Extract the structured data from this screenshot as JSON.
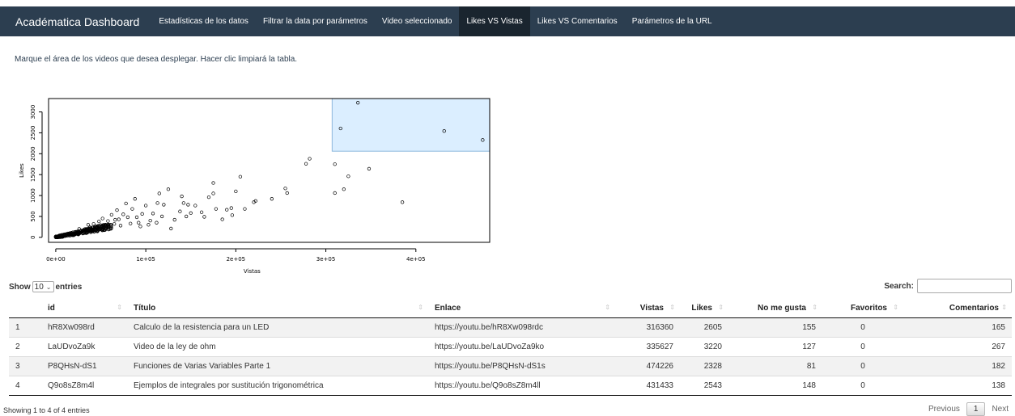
{
  "navbar": {
    "brand": "Académatica Dashboard",
    "tabs": [
      {
        "label": "Estadísticas de los datos",
        "active": false
      },
      {
        "label": "Filtrar la data por parámetros",
        "active": false
      },
      {
        "label": "Video seleccionado",
        "active": false
      },
      {
        "label": "Likes VS Vistas",
        "active": true
      },
      {
        "label": "Likes VS Comentarios",
        "active": false
      },
      {
        "label": "Parámetros de la URL",
        "active": false
      }
    ]
  },
  "instruction": "Marque el área de los videos que desea desplegar. Hacer clic limpiará la tabla.",
  "chart_data": {
    "type": "scatter",
    "xlabel": "Vistas",
    "ylabel": "Likes",
    "x_ticks": [
      0,
      100000,
      200000,
      300000,
      400000
    ],
    "x_tick_labels": [
      "0e+00",
      "1e+05",
      "2e+05",
      "3e+05",
      "4e+05"
    ],
    "y_ticks": [
      0,
      500,
      1000,
      1500,
      2000,
      2500,
      3000
    ],
    "y_tick_labels": [
      "0",
      "500",
      "1000",
      "1500",
      "2000",
      "2500",
      "3000"
    ],
    "xlim": [
      -8000,
      482000
    ],
    "ylim": [
      -120,
      3320
    ],
    "brush": {
      "x_min": 307000,
      "x_max": 482000,
      "y_min": 2060,
      "y_max": 3320,
      "color": "#dbeeff"
    },
    "points": [
      [
        316360,
        2605
      ],
      [
        335627,
        3220
      ],
      [
        474226,
        2328
      ],
      [
        431433,
        2543
      ],
      [
        282000,
        1880
      ],
      [
        278000,
        1760
      ],
      [
        310000,
        1750
      ],
      [
        348000,
        1640
      ],
      [
        325000,
        1460
      ],
      [
        320000,
        1150
      ],
      [
        310000,
        1060
      ],
      [
        385000,
        840
      ],
      [
        255000,
        1170
      ],
      [
        257000,
        1060
      ],
      [
        240000,
        920
      ],
      [
        222000,
        870
      ],
      [
        220000,
        840
      ],
      [
        205000,
        1450
      ],
      [
        200000,
        1100
      ],
      [
        195000,
        700
      ],
      [
        190000,
        660
      ],
      [
        196000,
        530
      ],
      [
        175000,
        1300
      ],
      [
        175000,
        1050
      ],
      [
        170000,
        960
      ],
      [
        178000,
        680
      ],
      [
        165000,
        490
      ],
      [
        150000,
        580
      ],
      [
        147000,
        780
      ],
      [
        145000,
        500
      ],
      [
        140000,
        980
      ],
      [
        138000,
        620
      ],
      [
        132000,
        420
      ],
      [
        128000,
        210
      ],
      [
        125000,
        1150
      ],
      [
        120000,
        780
      ],
      [
        118000,
        500
      ],
      [
        115000,
        1050
      ],
      [
        113000,
        820
      ],
      [
        108000,
        570
      ],
      [
        105000,
        400
      ],
      [
        100000,
        760
      ],
      [
        96000,
        560
      ],
      [
        92000,
        350
      ],
      [
        88000,
        920
      ],
      [
        85000,
        680
      ],
      [
        80000,
        480
      ],
      [
        78000,
        810
      ],
      [
        75000,
        550
      ],
      [
        70000,
        430
      ],
      [
        68000,
        650
      ],
      [
        65000,
        320
      ],
      [
        62000,
        540
      ],
      [
        58000,
        390
      ],
      [
        55000,
        300
      ],
      [
        52000,
        450
      ],
      [
        50000,
        250
      ],
      [
        48000,
        380
      ],
      [
        45000,
        180
      ],
      [
        42000,
        320
      ],
      [
        40000,
        140
      ],
      [
        38000,
        240
      ],
      [
        35000,
        110
      ],
      [
        32000,
        190
      ],
      [
        30000,
        90
      ],
      [
        28000,
        160
      ],
      [
        25000,
        70
      ],
      [
        22000,
        130
      ],
      [
        20000,
        50
      ],
      [
        18000,
        100
      ],
      [
        15000,
        40
      ],
      [
        12000,
        80
      ],
      [
        10000,
        30
      ],
      [
        8000,
        50
      ],
      [
        5000,
        20
      ],
      [
        3000,
        10
      ],
      [
        1000,
        5
      ],
      [
        60000,
        200
      ],
      [
        72000,
        280
      ],
      [
        83000,
        330
      ],
      [
        94000,
        260
      ],
      [
        103000,
        300
      ],
      [
        112000,
        350
      ],
      [
        90000,
        480
      ],
      [
        66000,
        420
      ],
      [
        54000,
        180
      ],
      [
        46000,
        260
      ],
      [
        36000,
        300
      ],
      [
        26000,
        200
      ],
      [
        142000,
        820
      ],
      [
        155000,
        760
      ],
      [
        162000,
        600
      ],
      [
        185000,
        430
      ],
      [
        210000,
        680
      ]
    ],
    "dense_cluster": {
      "x_max": 62000,
      "y_max": 300,
      "count": 260
    }
  },
  "table": {
    "show_label": "Show",
    "entries_label": "entries",
    "page_length": "10",
    "search_label": "Search:",
    "columns": [
      "id",
      "Título",
      "Enlace",
      "Vistas",
      "Likes",
      "No me gusta",
      "Favoritos",
      "Comentarios"
    ],
    "rows": [
      {
        "n": "1",
        "id": "hR8Xw098rd",
        "titulo": "Calculo de la resistencia para un LED",
        "enlace": "https://youtu.be/hR8Xw098rdc",
        "vistas": "316360",
        "likes": "2605",
        "dislikes": "155",
        "favoritos": "0",
        "comentarios": "165"
      },
      {
        "n": "2",
        "id": "LaUDvoZa9k",
        "titulo": "Video de la ley de ohm",
        "enlace": "https://youtu.be/LaUDvoZa9ko",
        "vistas": "335627",
        "likes": "3220",
        "dislikes": "127",
        "favoritos": "0",
        "comentarios": "267"
      },
      {
        "n": "3",
        "id": "P8QHsN-dS1",
        "titulo": "Funciones de Varias Variables Parte 1",
        "enlace": "https://youtu.be/P8QHsN-dS1s",
        "vistas": "474226",
        "likes": "2328",
        "dislikes": "81",
        "favoritos": "0",
        "comentarios": "182"
      },
      {
        "n": "4",
        "id": "Q9o8sZ8m4l",
        "titulo": "Ejemplos de integrales por sustitución trigonométrica",
        "enlace": "https://youtu.be/Q9o8sZ8m4ll",
        "vistas": "431433",
        "likes": "2543",
        "dislikes": "148",
        "favoritos": "0",
        "comentarios": "138"
      }
    ],
    "info": "Showing 1 to 4 of 4 entries",
    "paging": {
      "previous": "Previous",
      "current": "1",
      "next": "Next"
    }
  }
}
